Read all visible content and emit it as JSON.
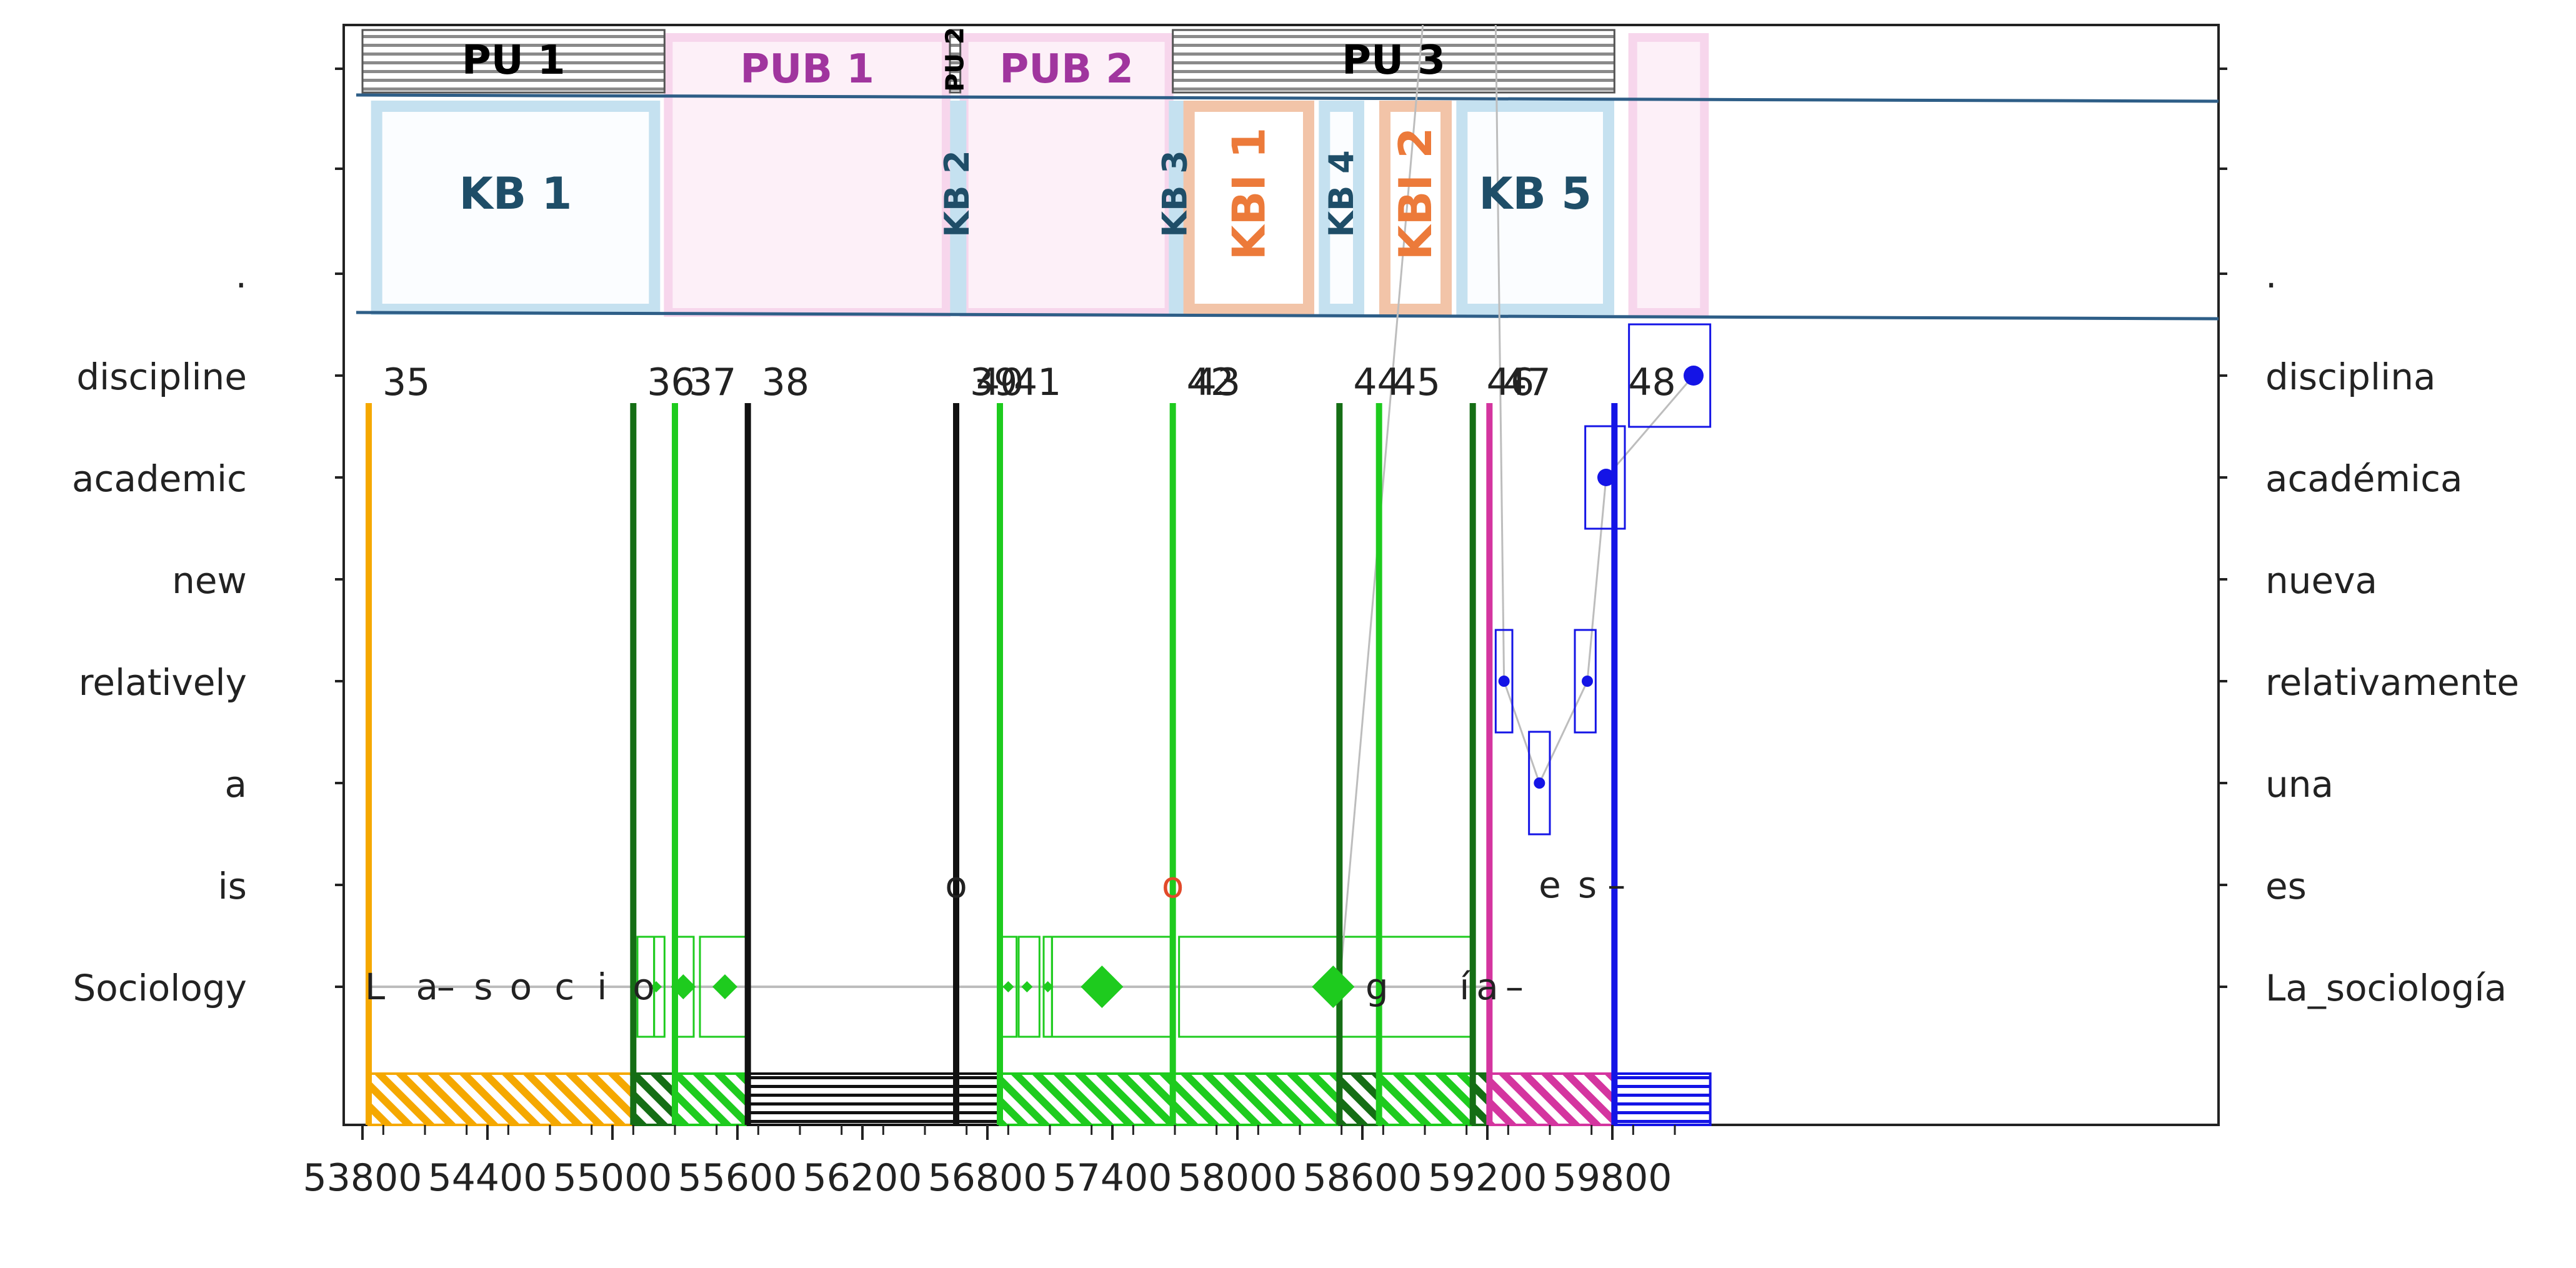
{
  "colors": {
    "pu": "#c8c8c8",
    "pub_fill": "#fdf0f8",
    "pub_edge": "#f7d6ec",
    "pub_text": "#a0359e",
    "kb_fill": "#fbfdff",
    "kb_edge": "#c5e1f0",
    "kb_text": "#1f4e68",
    "kbi_fill": "#ffffff",
    "kbi_edge": "#f2c4a8",
    "kbi_text": "#ec7a3a",
    "orange": "#f5a800",
    "green": "#1ecb1e",
    "dark_green": "#156e15",
    "black": "#111111",
    "magenta": "#d4359f",
    "blue": "#1414e6",
    "band_line": "#2e5e87",
    "grey_line": "#bdbdbd"
  },
  "chart_data": {
    "type": "scatter",
    "title": "",
    "xlabel": "",
    "ylabel": "",
    "xlim": [
      53750,
      60300
    ],
    "xticks": [
      "53800",
      "54400",
      "55000",
      "55600",
      "56200",
      "56800",
      "57400",
      "58000",
      "58600",
      "59200",
      "59800"
    ],
    "rows_left": [
      ".",
      "discipline",
      "academic",
      "new",
      "relatively",
      "a",
      "is",
      "Sociology"
    ],
    "rows_right": [
      ".",
      "disciplina",
      "académica",
      "nueva",
      "relativamente",
      "una",
      "es",
      "La_sociología"
    ],
    "pu_units": [
      {
        "label": "PU 1",
        "start": 53800,
        "end": 55250,
        "vertical": false
      },
      {
        "label": "PU 2",
        "start": 56620,
        "end": 56670,
        "vertical": true
      },
      {
        "label": "PU 3",
        "start": 57690,
        "end": 59810,
        "vertical": false
      }
    ],
    "pub_units": [
      {
        "label": "PUB 1",
        "start": 55250,
        "end": 56620,
        "vertical": false
      },
      {
        "label": "PUB 2",
        "start": 56670,
        "end": 57690,
        "vertical": false
      },
      {
        "label": "",
        "start": 59880,
        "end": 60260,
        "vertical": false
      }
    ],
    "kb_units": [
      {
        "label": "KB 1",
        "kind": "KB",
        "start": 53850,
        "end": 55220,
        "vertical": false
      },
      {
        "label": "KB 2",
        "kind": "KB",
        "start": 56630,
        "end": 56680,
        "vertical": true
      },
      {
        "label": "KB 3",
        "kind": "KB",
        "start": 57680,
        "end": 57720,
        "vertical": true
      },
      {
        "label": "KBI 1",
        "kind": "KBI",
        "start": 57750,
        "end": 58360,
        "vertical": true
      },
      {
        "label": "KB 4",
        "kind": "KB",
        "start": 58400,
        "end": 58600,
        "vertical": true
      },
      {
        "label": "KBI 2",
        "kind": "KBI",
        "start": 58690,
        "end": 59020,
        "vertical": true
      },
      {
        "label": "KB 5",
        "kind": "KB",
        "start": 59060,
        "end": 59800,
        "vertical": false
      }
    ],
    "fixations": [
      {
        "label": "35",
        "x": 53830,
        "color": "orange"
      },
      {
        "label": "36",
        "x": 55100,
        "color": "dark_green"
      },
      {
        "label": "37",
        "x": 55300,
        "color": "green"
      },
      {
        "label": "38",
        "x": 55650,
        "color": "black"
      },
      {
        "label": "39",
        "x": 56650,
        "color": "black"
      },
      {
        "label": "40",
        "x": 56650,
        "color": "black"
      },
      {
        "label": "41",
        "x": 56860,
        "color": "green"
      },
      {
        "label": "42",
        "x": 57690,
        "color": "green"
      },
      {
        "label": "43",
        "x": 57690,
        "color": "green"
      },
      {
        "label": "44",
        "x": 58490,
        "color": "dark_green"
      },
      {
        "label": "45",
        "x": 58680,
        "color": "green"
      },
      {
        "label": "46",
        "x": 59130,
        "color": "dark_green"
      },
      {
        "label": "47",
        "x": 59210,
        "color": "magenta"
      },
      {
        "label": "48",
        "x": 59810,
        "color": "blue"
      }
    ],
    "letters_sociology": [
      {
        "text": "L",
        "x": 53860
      },
      {
        "text": "a",
        "x": 54110
      },
      {
        "text": "–",
        "x": 54200
      },
      {
        "text": "s",
        "x": 54380
      },
      {
        "text": "o",
        "x": 54560
      },
      {
        "text": "c",
        "x": 54770
      },
      {
        "text": "i",
        "x": 54950
      },
      {
        "text": "o",
        "x": 55150
      },
      {
        "text": "g",
        "x": 58670
      },
      {
        "text": "í",
        "x": 59090
      },
      {
        "text": "a",
        "x": 59200
      },
      {
        "text": "–",
        "x": 59330
      }
    ],
    "letters_is": [
      {
        "text": "o",
        "x": 56650,
        "color": "black"
      },
      {
        "text": "o",
        "x": 57690,
        "color": "red"
      },
      {
        "text": "e",
        "x": 59500,
        "color": "black"
      },
      {
        "text": "s",
        "x": 59680,
        "color": "black"
      },
      {
        "text": "–",
        "x": 59820,
        "color": "black"
      }
    ],
    "green_boxes": [
      {
        "start": 55120,
        "end": 55200
      },
      {
        "start": 55200,
        "end": 55250
      },
      {
        "start": 55290,
        "end": 55390
      },
      {
        "start": 55420,
        "end": 55650
      },
      {
        "start": 56860,
        "end": 56940
      },
      {
        "start": 56950,
        "end": 57050
      },
      {
        "start": 57070,
        "end": 57110
      },
      {
        "start": 57110,
        "end": 57680
      },
      {
        "start": 57720,
        "end": 59140
      }
    ],
    "green_diamonds": [
      {
        "x": 55210,
        "size": "small"
      },
      {
        "x": 55340,
        "size": "medium"
      },
      {
        "x": 55540,
        "size": "medium"
      },
      {
        "x": 56900,
        "size": "small"
      },
      {
        "x": 56990,
        "size": "small"
      },
      {
        "x": 57090,
        "size": "small"
      },
      {
        "x": 57350,
        "size": "large"
      },
      {
        "x": 58460,
        "size": "large"
      }
    ],
    "blue_points": [
      {
        "row": "relatively",
        "x": 59280,
        "box": [
          59240,
          59320
        ]
      },
      {
        "row": "a",
        "x": 59450,
        "box": [
          59400,
          59500
        ]
      },
      {
        "row": "relatively",
        "x": 59680,
        "box": [
          59620,
          59720
        ]
      },
      {
        "row": "academic",
        "x": 59770,
        "box": [
          59670,
          59860
        ]
      },
      {
        "row": "discipline",
        "x": 60190,
        "box": [
          59880,
          60270
        ]
      }
    ],
    "hatch_segments": [
      {
        "start": 53830,
        "end": 55100,
        "color": "orange"
      },
      {
        "start": 55100,
        "end": 55300,
        "color": "dark_green"
      },
      {
        "start": 55300,
        "end": 55650,
        "color": "green"
      },
      {
        "start": 55650,
        "end": 56650,
        "color": "black"
      },
      {
        "start": 56650,
        "end": 56860,
        "color": "black"
      },
      {
        "start": 56860,
        "end": 57690,
        "color": "green"
      },
      {
        "start": 57690,
        "end": 58490,
        "color": "green"
      },
      {
        "start": 58490,
        "end": 58680,
        "color": "dark_green"
      },
      {
        "start": 58680,
        "end": 59130,
        "color": "green"
      },
      {
        "start": 59130,
        "end": 59210,
        "color": "dark_green"
      },
      {
        "start": 59210,
        "end": 59810,
        "color": "magenta"
      },
      {
        "start": 59810,
        "end": 60270,
        "color": "blue"
      }
    ]
  }
}
